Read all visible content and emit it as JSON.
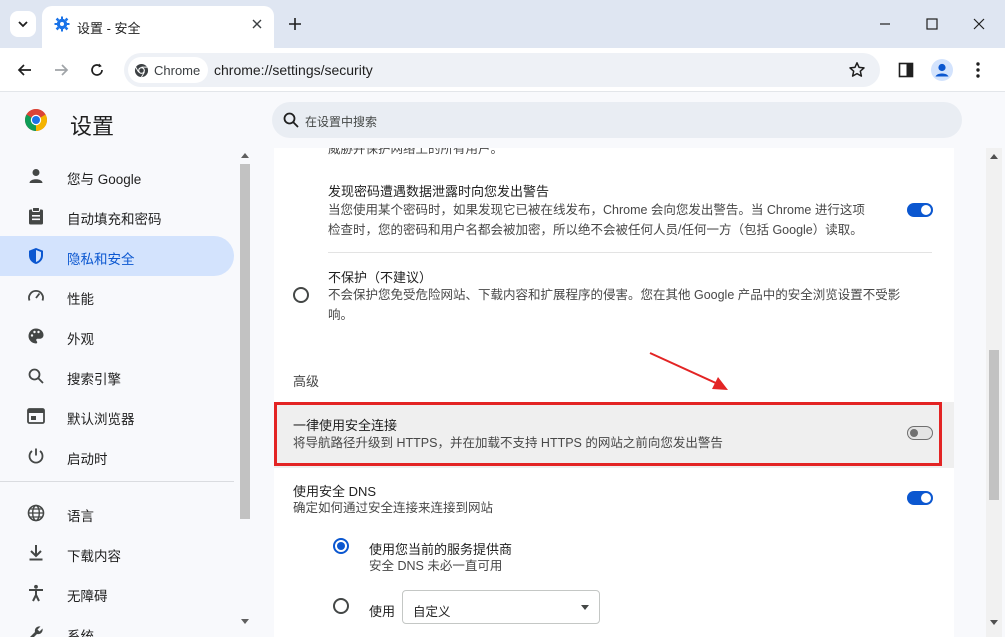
{
  "tab": {
    "title": "设置 - 安全"
  },
  "omnibox": {
    "chip_label": "Chrome",
    "url": "chrome://settings/security"
  },
  "header": {
    "title": "设置",
    "search_placeholder": "在设置中搜索"
  },
  "sidebar": {
    "items": [
      {
        "label": "您与 Google",
        "icon": "person-icon"
      },
      {
        "label": "自动填充和密码",
        "icon": "clipboard-icon"
      },
      {
        "label": "隐私和安全",
        "icon": "shield-icon",
        "active": true
      },
      {
        "label": "性能",
        "icon": "speedometer-icon"
      },
      {
        "label": "外观",
        "icon": "palette-icon"
      },
      {
        "label": "搜索引擎",
        "icon": "search-icon"
      },
      {
        "label": "默认浏览器",
        "icon": "browser-icon"
      },
      {
        "label": "启动时",
        "icon": "power-icon"
      },
      {
        "label": "语言",
        "icon": "globe-icon"
      },
      {
        "label": "下载内容",
        "icon": "download-icon"
      },
      {
        "label": "无障碍",
        "icon": "accessibility-icon"
      },
      {
        "label": "系统",
        "icon": "wrench-icon"
      }
    ]
  },
  "content": {
    "clipped_top_text": "威胁并保护网络上的所有用户。",
    "leak_warning": {
      "title": "发现密码遭遇数据泄露时向您发出警告",
      "desc_line1": "当您使用某个密码时，如果发现它已被在线发布，Chrome 会向您发出警告。当 Chrome 进行这项",
      "desc_line2": "检查时，您的密码和用户名都会被加密，所以绝不会被任何人员/任何一方（包括 Google）读取。",
      "enabled": true
    },
    "no_protection": {
      "title": "不保护（不建议）",
      "desc_line1": "不会保护您免受危险网站、下载内容和扩展程序的侵害。您在其他 Google 产品中的安全浏览设置不受影",
      "desc_line2": "响。",
      "selected": false
    },
    "advanced_heading": "高级",
    "https_only": {
      "title": "一律使用安全连接",
      "desc": "将导航路径升级到 HTTPS，并在加载不支持 HTTPS 的网站之前向您发出警告",
      "enabled": false
    },
    "secure_dns": {
      "title": "使用安全 DNS",
      "desc": "确定如何通过安全连接来连接到网站",
      "enabled": true
    },
    "dns_current_provider": {
      "title": "使用您当前的服务提供商",
      "desc": "安全 DNS 未必一直可用",
      "selected": true
    },
    "dns_custom": {
      "label": "使用",
      "select_value": "自定义",
      "selected": false
    }
  },
  "colors": {
    "accent": "#0b57d0",
    "annotation": "#e32424",
    "active_nav_bg": "#d3e3fd"
  }
}
